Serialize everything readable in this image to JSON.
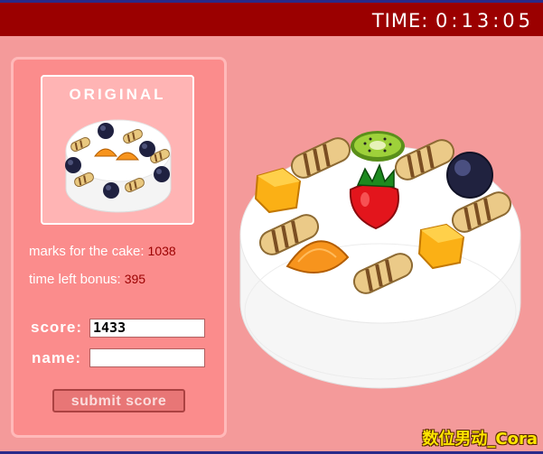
{
  "timer": {
    "label": "TIME:",
    "value": "0:13:05"
  },
  "panel": {
    "original_title": "ORIGINAL",
    "marks_label": "marks for the cake:",
    "marks_value": "1038",
    "bonus_label": "time left bonus:",
    "bonus_value": "395",
    "score_label": "score:",
    "score_value": "1433",
    "name_label": "name:",
    "name_value": "",
    "submit_label": "submit score"
  },
  "watermark": "数位男动_Cora",
  "colors": {
    "topbar": "#9b0000",
    "background": "#f49a9a",
    "panel": "#fb8c8c",
    "stat_number": "#9b0000"
  }
}
